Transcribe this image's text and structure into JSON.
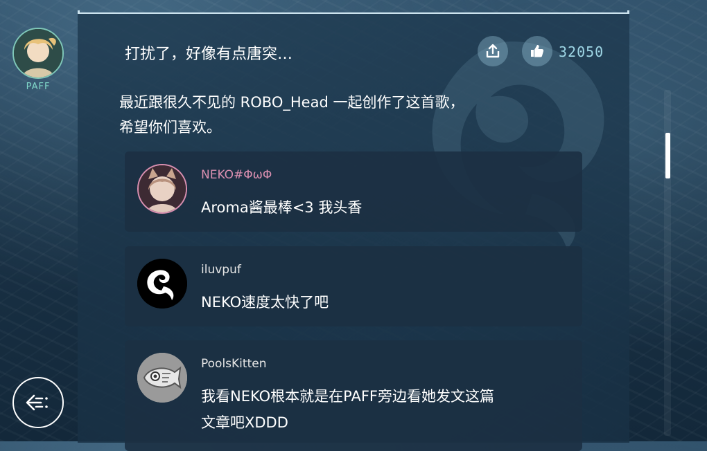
{
  "post": {
    "author": "PAFF",
    "title": "打扰了，好像有点唐突…",
    "like_count": "32050",
    "body_line1": "最近跟很久不见的 ROBO_Head 一起创作了这首歌，",
    "body_line2": "希望你们喜欢。"
  },
  "comments": [
    {
      "name": "NEKO#ΦωΦ",
      "text": "Aroma酱最棒<3 我头香",
      "name_color": "#d98fb0"
    },
    {
      "name": "iluvpuf",
      "text": "NEKO速度太快了吧",
      "name_color": "#e6e6e6"
    },
    {
      "name": "PoolsKitten",
      "text_line1": "我看NEKO根本就是在PAFF旁边看她发文这篇",
      "text_line2": "文章吧XDDD",
      "name_color": "#e6e6e6"
    }
  ],
  "icons": {
    "share": "share-icon",
    "like": "thumbs-up-icon",
    "back": "back-arrow-icon"
  },
  "colors": {
    "accent": "#9fd7e6",
    "author_name": "#7fd6c8",
    "neko_name": "#d98fb0"
  }
}
